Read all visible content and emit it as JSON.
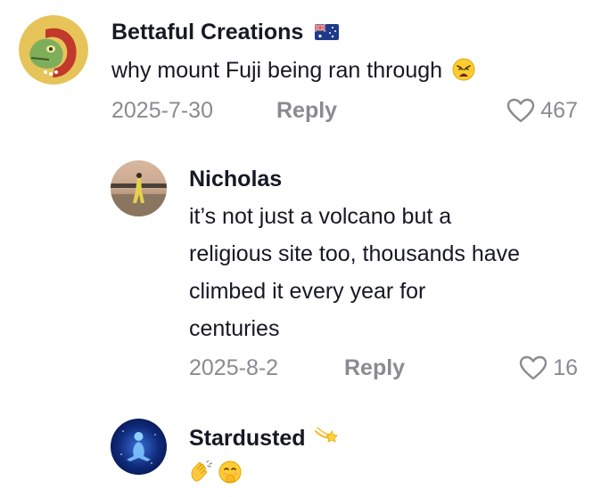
{
  "comments": [
    {
      "username": "Bettaful Creations",
      "username_badge": "australia-flag-icon",
      "text": "why mount Fuji being ran through",
      "text_emoji": "weary-face-icon",
      "date": "2025-7-30",
      "reply_label": "Reply",
      "likes": "467"
    },
    {
      "username": "Nicholas",
      "text_lines": [
        "it’s not just a volcano but a",
        "religious site too, thousands have",
        "climbed it every year for",
        "centuries"
      ],
      "date": "2025-8-2",
      "reply_label": "Reply",
      "likes": "16"
    },
    {
      "username": "Stardusted",
      "username_badge": "dizzy-icon",
      "text_emojis": [
        "clapping-hands-icon",
        "hand-over-mouth-face-icon"
      ]
    }
  ],
  "colors": {
    "primary_text": "#161823",
    "secondary_text": "#8a8b91"
  }
}
